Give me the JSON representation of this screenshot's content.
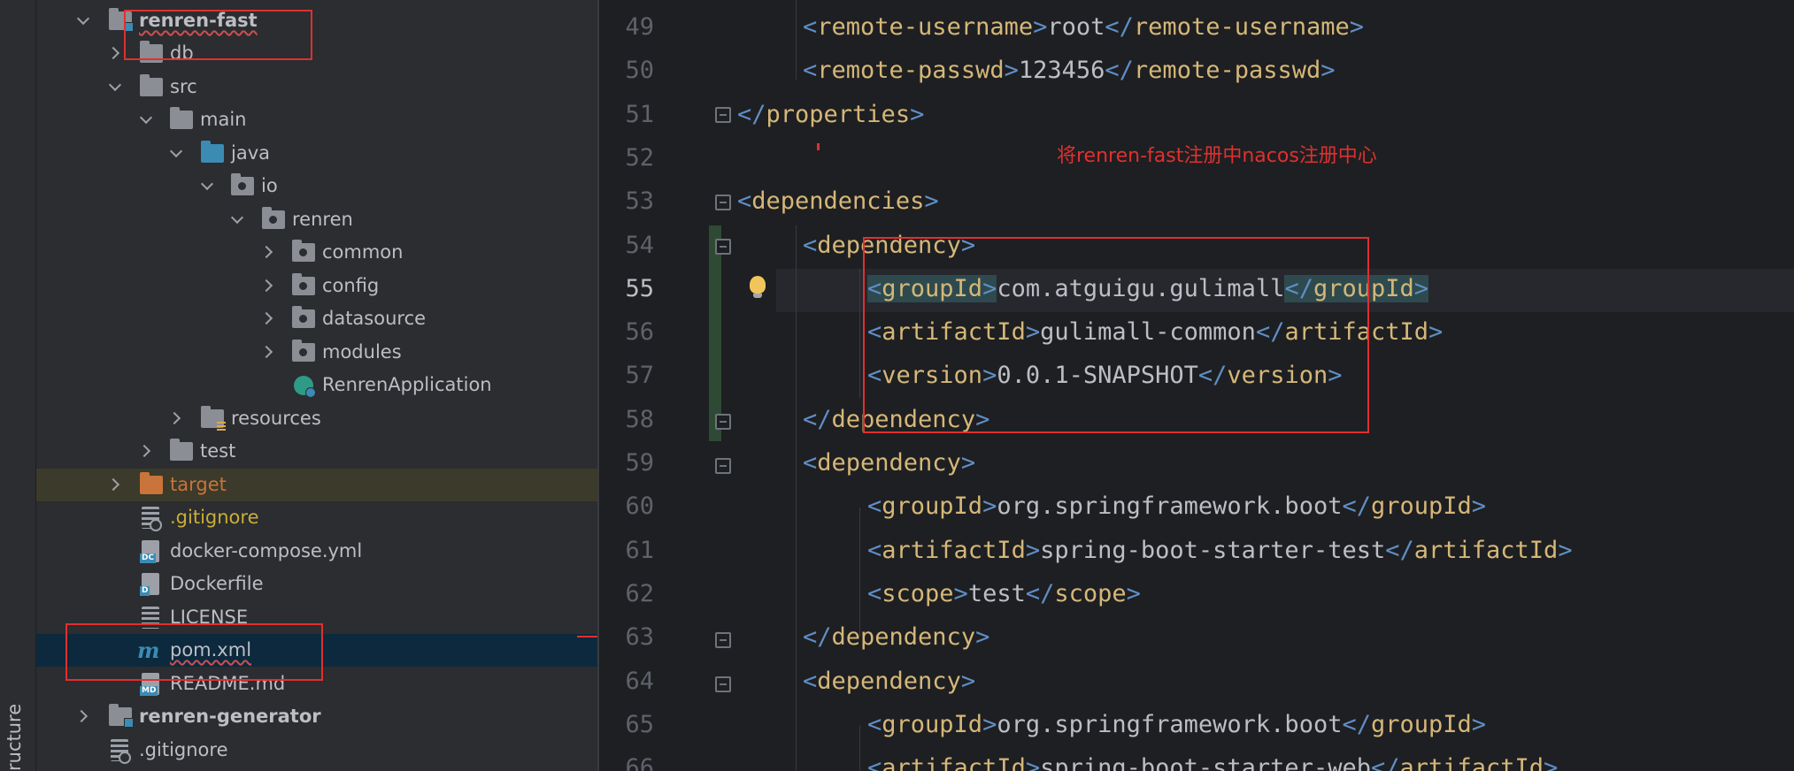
{
  "sidebar": {
    "tool_window_label": "ructure"
  },
  "project_tree": {
    "items": [
      {
        "label": "renren-fast",
        "depth": 0,
        "icon": "module-folder-icon",
        "chevron": "down",
        "bold": true
      },
      {
        "label": "db",
        "depth": 1,
        "icon": "folder-icon",
        "chevron": "right"
      },
      {
        "label": "src",
        "depth": 1,
        "icon": "folder-icon",
        "chevron": "down"
      },
      {
        "label": "main",
        "depth": 2,
        "icon": "folder-icon",
        "chevron": "down"
      },
      {
        "label": "java",
        "depth": 3,
        "icon": "source-folder-icon",
        "chevron": "down"
      },
      {
        "label": "io",
        "depth": 4,
        "icon": "package-icon",
        "chevron": "down"
      },
      {
        "label": "renren",
        "depth": 5,
        "icon": "package-icon",
        "chevron": "down"
      },
      {
        "label": "common",
        "depth": 6,
        "icon": "package-icon",
        "chevron": "right"
      },
      {
        "label": "config",
        "depth": 6,
        "icon": "package-icon",
        "chevron": "right"
      },
      {
        "label": "datasource",
        "depth": 6,
        "icon": "package-icon",
        "chevron": "right"
      },
      {
        "label": "modules",
        "depth": 6,
        "icon": "package-icon",
        "chevron": "right"
      },
      {
        "label": "RenrenApplication",
        "depth": 7,
        "icon": "spring-boot-app-icon",
        "chevron": ""
      },
      {
        "label": "resources",
        "depth": 3,
        "icon": "resources-folder-icon",
        "chevron": "right"
      },
      {
        "label": "test",
        "depth": 2,
        "icon": "folder-icon",
        "chevron": "right"
      },
      {
        "label": "target",
        "depth": 1,
        "icon": "excluded-folder-icon",
        "chevron": "right"
      },
      {
        "label": ".gitignore",
        "depth": 2,
        "icon": "gitignore-file-icon",
        "chevron": ""
      },
      {
        "label": "docker-compose.yml",
        "depth": 2,
        "icon": "docker-compose-file-icon",
        "chevron": ""
      },
      {
        "label": "Dockerfile",
        "depth": 2,
        "icon": "dockerfile-icon",
        "chevron": ""
      },
      {
        "label": "LICENSE",
        "depth": 2,
        "icon": "text-file-icon",
        "chevron": ""
      },
      {
        "label": "pom.xml",
        "depth": 2,
        "icon": "maven-file-icon",
        "chevron": ""
      },
      {
        "label": "README.md",
        "depth": 2,
        "icon": "markdown-file-icon",
        "chevron": ""
      },
      {
        "label": "renren-generator",
        "depth": 0,
        "icon": "module-folder-icon",
        "chevron": "right",
        "bold": true
      },
      {
        "label": ".gitignore",
        "depth": 1,
        "icon": "gitignore-file-icon",
        "chevron": ""
      }
    ],
    "icon_tags": {
      "docker_compose": "DC",
      "dockerfile": "D",
      "markdown": "MD",
      "maven": "m"
    }
  },
  "editor": {
    "current_line": 55,
    "annotation": "将renren-fast注册中nacos注册中心",
    "lines": [
      {
        "n": "49",
        "open": "remote-username",
        "text": "root",
        "close": "remote-username"
      },
      {
        "n": "50",
        "open": "remote-passwd",
        "text": "123456",
        "close": "remote-passwd"
      },
      {
        "n": "51",
        "close": "properties"
      },
      {
        "n": "52"
      },
      {
        "n": "53",
        "open": "dependencies"
      },
      {
        "n": "54",
        "open": "dependency"
      },
      {
        "n": "55",
        "open": "groupId",
        "text": "com.atguigu.gulimall",
        "close": "groupId"
      },
      {
        "n": "56",
        "open": "artifactId",
        "text": "gulimall-common",
        "close": "artifactId"
      },
      {
        "n": "57",
        "open": "version",
        "text": "0.0.1-SNAPSHOT",
        "close": "version"
      },
      {
        "n": "58",
        "close": "dependency"
      },
      {
        "n": "59",
        "open": "dependency"
      },
      {
        "n": "60",
        "open": "groupId",
        "text": "org.springframework.boot",
        "close": "groupId"
      },
      {
        "n": "61",
        "open": "artifactId",
        "text": "spring-boot-starter-test",
        "close": "artifactId"
      },
      {
        "n": "62",
        "open": "scope",
        "text": "test",
        "close": "scope"
      },
      {
        "n": "63",
        "close": "dependency"
      },
      {
        "n": "64",
        "open": "dependency"
      },
      {
        "n": "65",
        "open": "groupId",
        "text": "org.springframework.boot",
        "close": "groupId"
      },
      {
        "n": "66",
        "open": "artifactId",
        "text": "spring-boot-starter-web",
        "close": "artifactId"
      }
    ]
  },
  "colors": {
    "bracket": "#5f8ec6",
    "tag": "#d5b778",
    "text": "#bcbec4",
    "annotation_red": "#e0302f",
    "selection": "#0d293e"
  }
}
